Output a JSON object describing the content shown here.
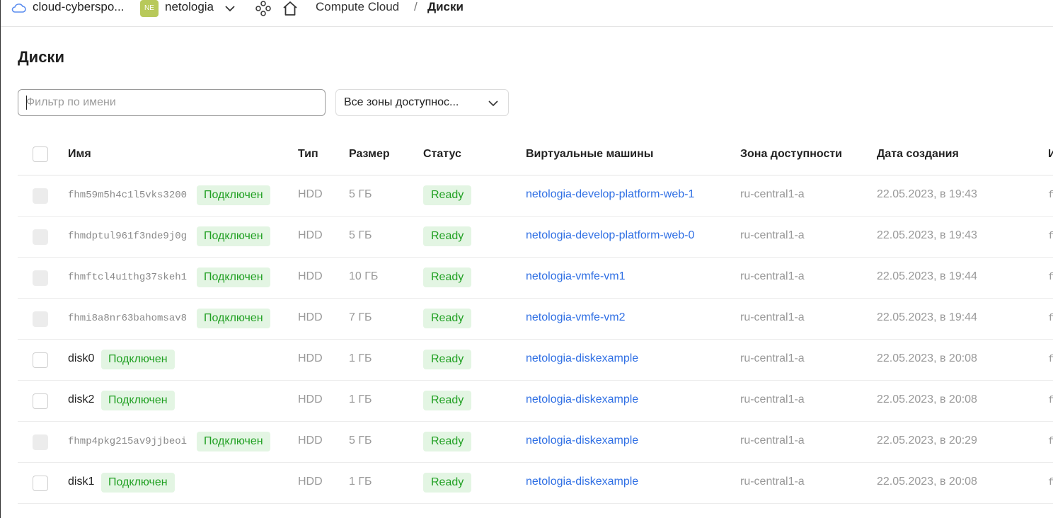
{
  "topbar": {
    "cloud_name": "cloud-cyberspo...",
    "folder_badge": "NE",
    "folder_name": "netologia",
    "crumbs": [
      "Compute Cloud",
      "Диски"
    ],
    "crumb_separator": "/"
  },
  "page_title": "Диски",
  "filter": {
    "placeholder": "Фильтр по имени",
    "value": ""
  },
  "zone_select": {
    "value": "Все зоны доступнос..."
  },
  "table": {
    "headers": {
      "name": "Имя",
      "type": "Тип",
      "size": "Размер",
      "status": "Статус",
      "vms": "Виртуальные машины",
      "zone": "Зона доступности",
      "created": "Дата создания",
      "extra": "И"
    },
    "rows": [
      {
        "name": "fhm59m5h4c1l5vks3200",
        "attached": "Подключен",
        "type": "HDD",
        "size": "5 ГБ",
        "status": "Ready",
        "vm": "netologia-develop-platform-web-1",
        "zone": "ru-central1-a",
        "created": "22.05.2023, в 19:43",
        "extra": "f"
      },
      {
        "name": "fhmdptul961f3nde9j0g",
        "attached": "Подключен",
        "type": "HDD",
        "size": "5 ГБ",
        "status": "Ready",
        "vm": "netologia-develop-platform-web-0",
        "zone": "ru-central1-a",
        "created": "22.05.2023, в 19:43",
        "extra": "f"
      },
      {
        "name": "fhmftcl4u1thg37skeh1",
        "attached": "Подключен",
        "type": "HDD",
        "size": "10 ГБ",
        "status": "Ready",
        "vm": "netologia-vmfe-vm1",
        "zone": "ru-central1-a",
        "created": "22.05.2023, в 19:44",
        "extra": "f"
      },
      {
        "name": "fhmi8a8nr63bahomsav8",
        "attached": "Подключен",
        "type": "HDD",
        "size": "7 ГБ",
        "status": "Ready",
        "vm": "netologia-vmfe-vm2",
        "zone": "ru-central1-a",
        "created": "22.05.2023, в 19:44",
        "extra": "f"
      },
      {
        "name": "disk0",
        "attached": "Подключен",
        "type": "HDD",
        "size": "1 ГБ",
        "status": "Ready",
        "vm": "netologia-diskexample",
        "zone": "ru-central1-a",
        "created": "22.05.2023, в 20:08",
        "extra": "f"
      },
      {
        "name": "disk2",
        "attached": "Подключен",
        "type": "HDD",
        "size": "1 ГБ",
        "status": "Ready",
        "vm": "netologia-diskexample",
        "zone": "ru-central1-a",
        "created": "22.05.2023, в 20:08",
        "extra": "f"
      },
      {
        "name": "fhmp4pkg215av9jjbeoi",
        "attached": "Подключен",
        "type": "HDD",
        "size": "5 ГБ",
        "status": "Ready",
        "vm": "netologia-diskexample",
        "zone": "ru-central1-a",
        "created": "22.05.2023, в 20:29",
        "extra": "f"
      },
      {
        "name": "disk1",
        "attached": "Подключен",
        "type": "HDD",
        "size": "1 ГБ",
        "status": "Ready",
        "vm": "netologia-diskexample",
        "zone": "ru-central1-a",
        "created": "22.05.2023, в 20:08",
        "extra": "f"
      }
    ]
  },
  "colors": {
    "link": "#2f6fe4",
    "success_text": "#20a022",
    "success_bg": "#e3f5e3",
    "folder_badge": "#b8c95a"
  }
}
